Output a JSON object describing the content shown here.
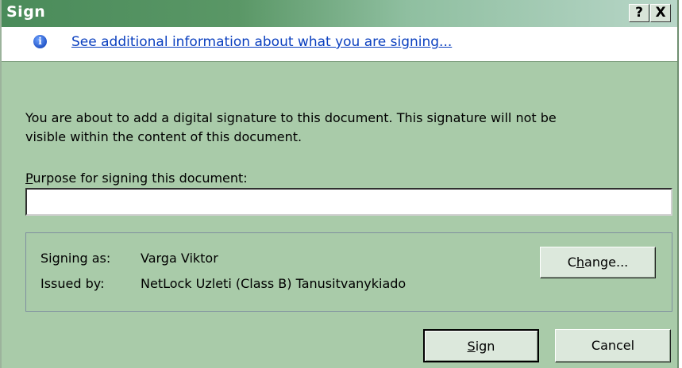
{
  "window": {
    "title": "Sign",
    "help_label": "?",
    "close_label": "X"
  },
  "info": {
    "icon": "info-icon",
    "icon_glyph": "i",
    "link_text": "See additional information about what you are signing..."
  },
  "description": {
    "line1": "You are about to add a digital signature to this document. This signature will not be",
    "line2": "visible within the content of this document."
  },
  "purpose": {
    "label_underlined": "P",
    "label_rest": "urpose for signing this document:",
    "value": "",
    "placeholder": ""
  },
  "signer": {
    "signing_as_label": "Signing as:",
    "signing_as_value": "Varga Viktor",
    "issued_by_label": "Issued by:",
    "issued_by_value": "NetLock Uzleti (Class B) Tanusitvanykiado",
    "change_pre": "C",
    "change_ul": "h",
    "change_post": "ange..."
  },
  "buttons": {
    "sign_ul": "S",
    "sign_rest": "ign",
    "cancel": "Cancel"
  },
  "colors": {
    "dialog_bg": "#a9cba9",
    "title_start": "#4a8b5a",
    "title_end": "#b8d6c8",
    "link": "#0a3fbf"
  }
}
